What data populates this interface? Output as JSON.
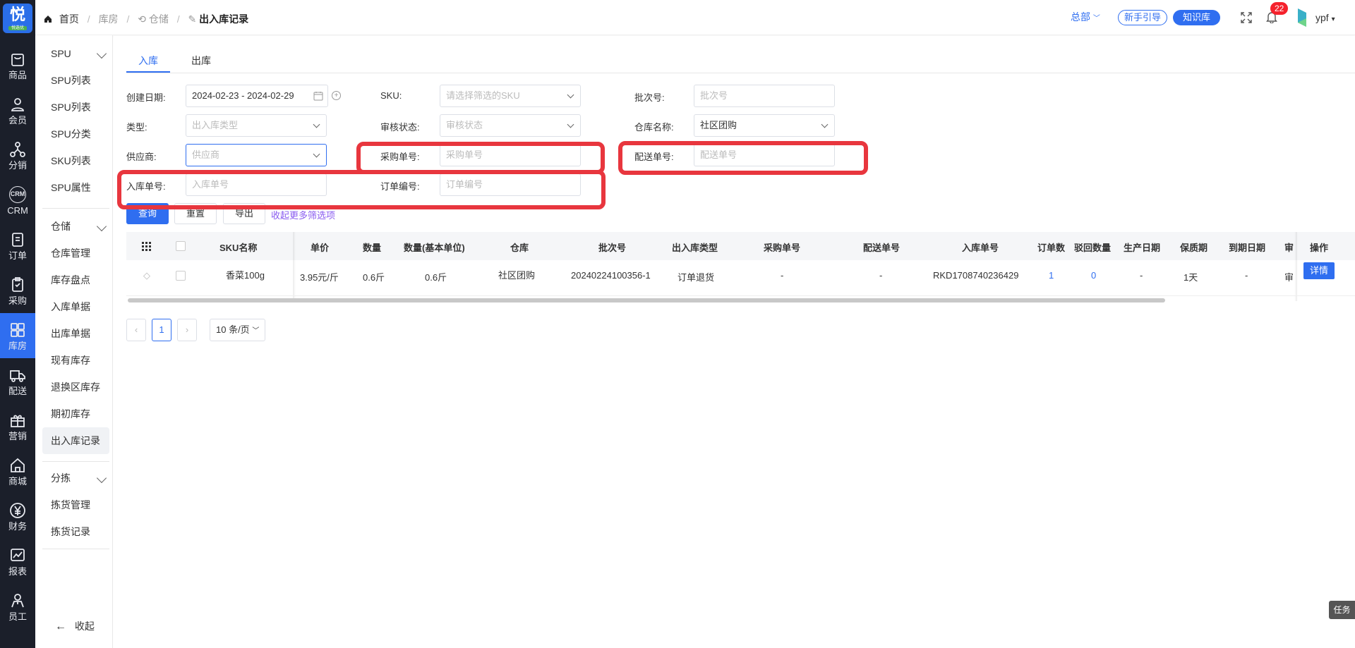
{
  "rail": {
    "logo": {
      "big": "悦",
      "small": "悦选优"
    },
    "items": [
      {
        "label": "商品",
        "icon": "bag-icon"
      },
      {
        "label": "会员",
        "icon": "user-icon"
      },
      {
        "label": "分销",
        "icon": "network-icon"
      },
      {
        "label": "CRM",
        "icon": "crm-icon"
      },
      {
        "label": "订单",
        "icon": "order-icon"
      },
      {
        "label": "采购",
        "icon": "purchase-icon"
      },
      {
        "label": "库房",
        "icon": "warehouse-icon"
      },
      {
        "label": "配送",
        "icon": "truck-icon"
      },
      {
        "label": "营销",
        "icon": "gift-icon"
      },
      {
        "label": "商城",
        "icon": "shop-icon"
      },
      {
        "label": "财务",
        "icon": "yen-icon"
      },
      {
        "label": "报表",
        "icon": "chart-icon"
      },
      {
        "label": "员工",
        "icon": "staff-icon"
      }
    ]
  },
  "submenu": {
    "spu": {
      "head": "SPU",
      "items": [
        "SPU列表",
        "SPU列表",
        "SPU分类",
        "SKU列表",
        "SPU属性"
      ]
    },
    "warehouse": {
      "head": "仓储",
      "items": [
        "仓库管理",
        "库存盘点",
        "入库单据",
        "出库单据",
        "现有库存",
        "退换区库存",
        "期初库存",
        "出入库记录"
      ]
    },
    "picking": {
      "head": "分拣",
      "items": [
        "拣货管理",
        "拣货记录"
      ]
    },
    "collapse": "收起"
  },
  "header": {
    "crumbs": [
      "首页",
      "库房",
      "仓储",
      "出入库记录"
    ],
    "hq": "总部",
    "guide": "新手引导",
    "kb": "知识库",
    "badge": "22",
    "user": "ypf"
  },
  "tabs": {
    "in": "入库",
    "out": "出库"
  },
  "filters": {
    "date": {
      "label": "创建日期:",
      "value": "2024-02-23 - 2024-02-29"
    },
    "sku": {
      "label": "SKU:",
      "placeholder": "请选择筛选的SKU"
    },
    "batch": {
      "label": "批次号:",
      "placeholder": "批次号"
    },
    "type": {
      "label": "类型:",
      "placeholder": "出入库类型"
    },
    "audit": {
      "label": "审核状态:",
      "placeholder": "审核状态"
    },
    "warehouse": {
      "label": "仓库名称:",
      "value": "社区团购"
    },
    "supplier": {
      "label": "供应商:",
      "placeholder": "供应商"
    },
    "purchase_no": {
      "label": "采购单号:",
      "placeholder": "采购单号"
    },
    "delivery_no": {
      "label": "配送单号:",
      "placeholder": "配送单号"
    },
    "inbound_no": {
      "label": "入库单号:",
      "placeholder": "入库单号"
    },
    "order_no": {
      "label": "订单编号:",
      "placeholder": "订单编号"
    }
  },
  "buttons": {
    "query": "查询",
    "reset": "重置",
    "export": "导出",
    "more": "收起更多筛选项"
  },
  "table": {
    "headers": [
      "SKU名称",
      "单价",
      "数量",
      "数量(基本单位)",
      "仓库",
      "批次号",
      "出入库类型",
      "采购单号",
      "配送单号",
      "入库单号",
      "订单数",
      "驳回数量",
      "生产日期",
      "保质期",
      "到期日期",
      "审",
      "操作"
    ],
    "row": [
      "香菜100g",
      "3.95元/斤",
      "0.6斤",
      "0.6斤",
      "社区团购",
      "20240224100356-1",
      "订单退货",
      "-",
      "-",
      "RKD1708740236429",
      "1",
      "0",
      "-",
      "1天",
      "-",
      "审"
    ],
    "action": "详情"
  },
  "pagination": {
    "prev": "‹",
    "page": "1",
    "next": "›",
    "size": "10 条/页"
  },
  "task": "任务",
  "colors": {
    "primary": "#2f6ef0",
    "rail": "#1b1f2a",
    "highlight": "#e8363e",
    "badge": "#f5222d"
  }
}
